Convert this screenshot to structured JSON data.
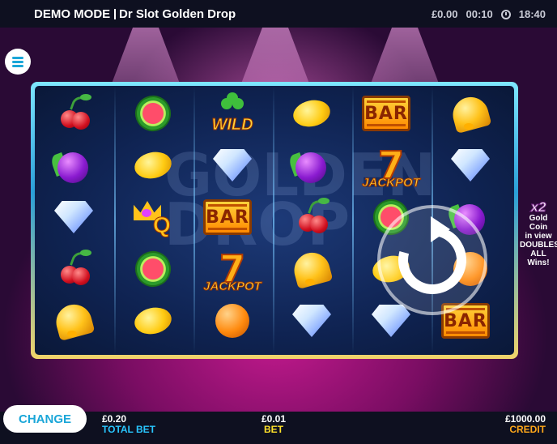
{
  "header": {
    "mode_label": "DEMO MODE",
    "game_title": "Dr Slot Golden Drop",
    "balance": "£0.00",
    "session_time": "00:10",
    "clock_time": "18:40"
  },
  "colors": {
    "accent_cyan": "#1aa6d8",
    "total_bet_label": "#29c7ff",
    "bet_label": "#ffe22a",
    "credit_label": "#ffa81a",
    "stage_magenta": "#c41a8e"
  },
  "reels": {
    "watermark_text": "GOLDEN DROP",
    "grid": [
      [
        "cherry",
        "melon",
        "wild",
        "lemon",
        "bar",
        "bell"
      ],
      [
        "plum",
        "lemon",
        "diamond",
        "plum",
        "jackpot",
        "diamond"
      ],
      [
        "diamond",
        "crown-q",
        "bar",
        "cherry",
        "melon",
        "plum"
      ],
      [
        "cherry",
        "melon",
        "jackpot",
        "bell",
        "lemon",
        "orange"
      ],
      [
        "bell",
        "lemon",
        "orange",
        "diamond",
        "diamond",
        "bar"
      ]
    ],
    "symbol_text": {
      "bar": "BAR",
      "jackpot_seven": "7",
      "jackpot_word": "JACKPOT",
      "wild": "WILD",
      "crown_letter": "Q"
    }
  },
  "promo": {
    "multiplier": "x2",
    "line1": "Gold Coin",
    "line2": "in view",
    "line3": "DOUBLES",
    "line4": "ALL Wins!"
  },
  "footer": {
    "change_label": "CHANGE",
    "total_bet_value": "£0.20",
    "total_bet_label": "TOTAL BET",
    "bet_value": "£0.01",
    "bet_label": "BET",
    "credit_value": "£1000.00",
    "credit_label": "CREDIT"
  }
}
